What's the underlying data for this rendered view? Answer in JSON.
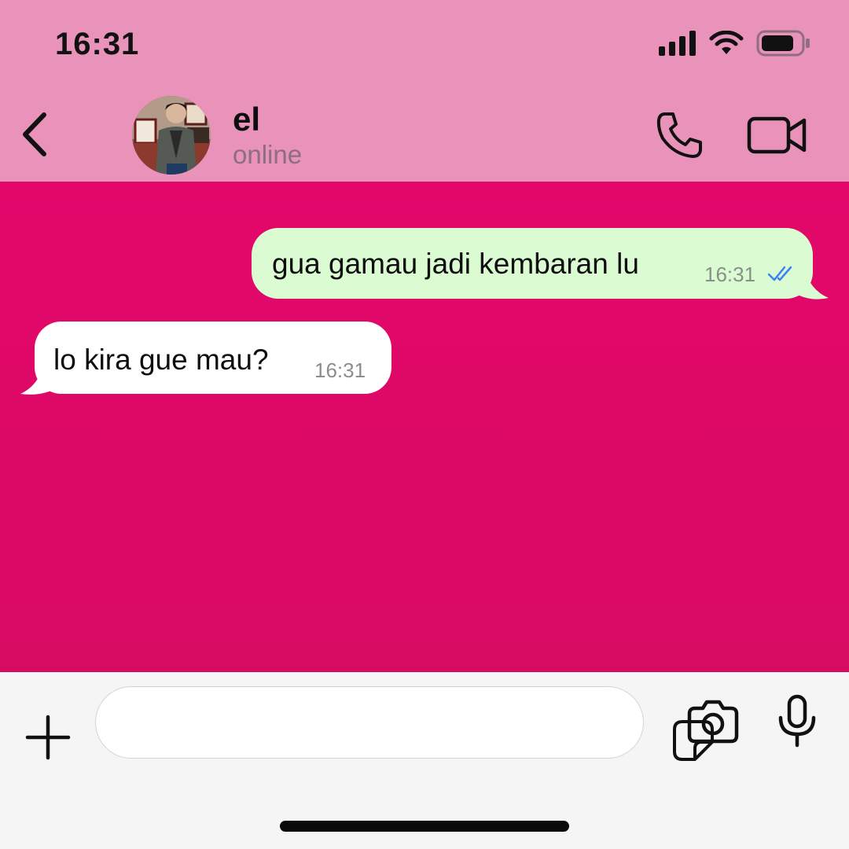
{
  "status_bar": {
    "time": "16:31"
  },
  "header": {
    "contact_name": "el",
    "contact_status": "online"
  },
  "messages": [
    {
      "direction": "outgoing",
      "text": "gua gamau jadi kembaran lu",
      "time": "16:31",
      "read": true
    },
    {
      "direction": "incoming",
      "text": "lo kira gue mau?",
      "time": "16:31"
    }
  ],
  "composer": {
    "placeholder": ""
  },
  "colors": {
    "header_bg": "#e993bb",
    "chat_bg": "#e3076a",
    "outgoing_bubble": "#dbfbd2",
    "incoming_bubble": "#ffffff",
    "read_tick": "#3b82f6"
  },
  "icons": [
    "back-chevron-icon",
    "phone-icon",
    "video-camera-icon",
    "plus-icon",
    "sticker-icon",
    "camera-icon",
    "microphone-icon"
  ]
}
